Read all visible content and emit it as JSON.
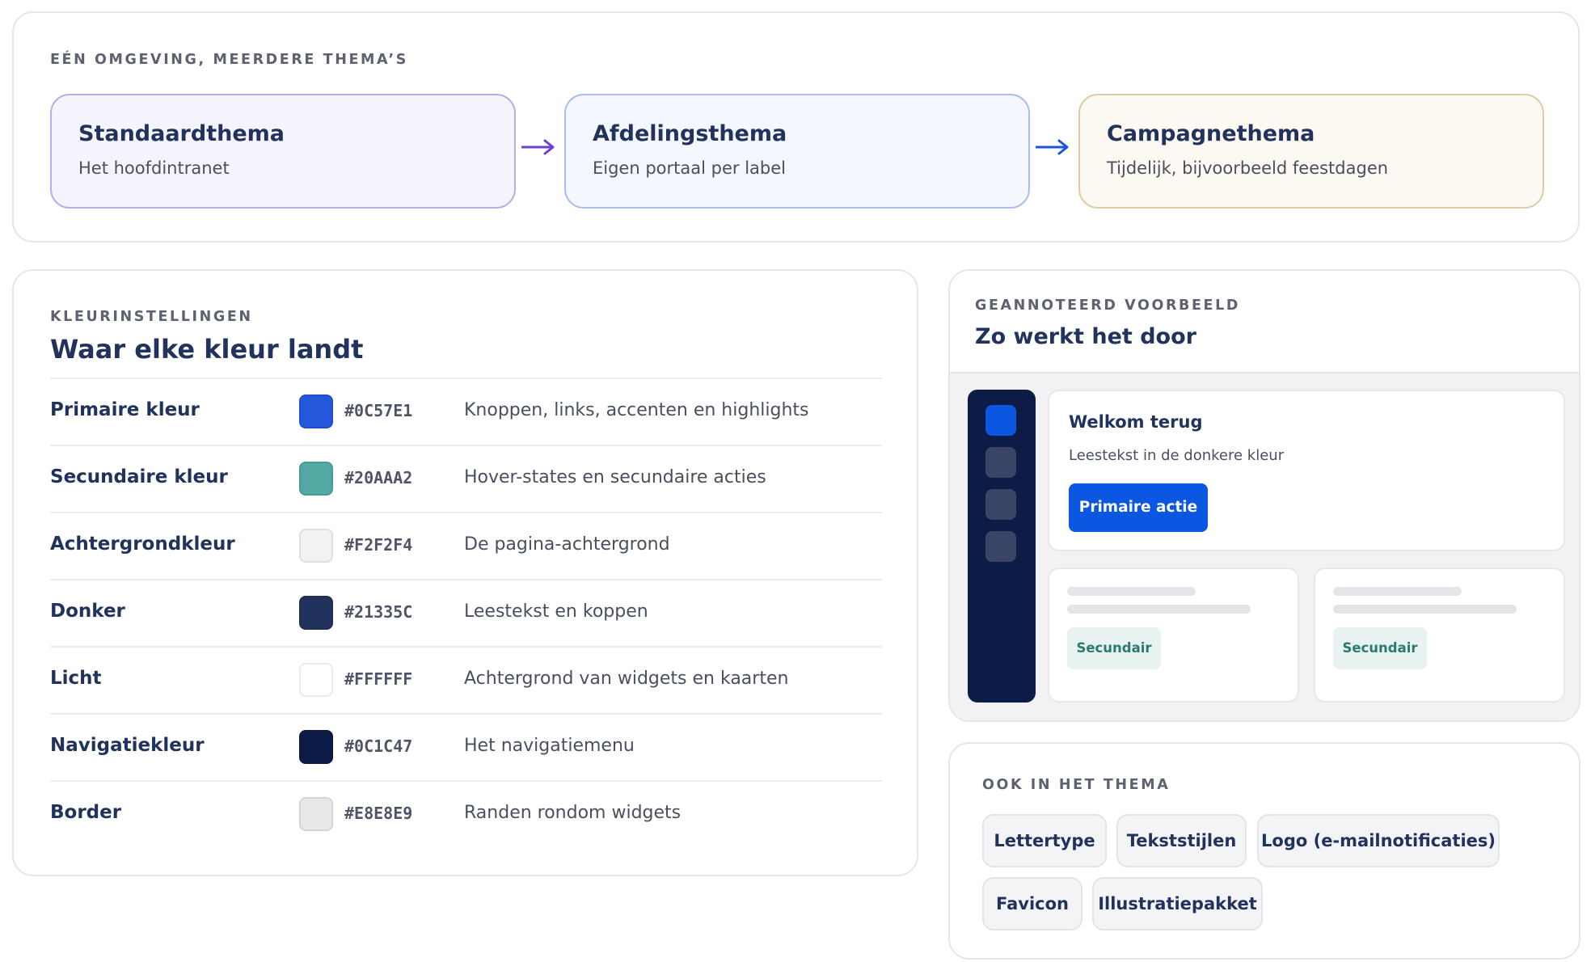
{
  "themes": {
    "heading": "EÉN OMGEVING, MEERDERE THEMA’S",
    "items": [
      {
        "title": "Standaardthema",
        "subtitle": "Het hoofdintranet",
        "border": "#b5aee6",
        "bg": "#f5f4fc"
      },
      {
        "title": "Afdelingsthema",
        "subtitle": "Eigen portaal per label",
        "border": "#a9bdee",
        "bg": "#f4f7fd"
      },
      {
        "title": "Campagnethema",
        "subtitle": "Tijdelijk, bijvoorbeeld feestdagen",
        "border": "#e0cba7",
        "bg": "#fcf8f2"
      }
    ],
    "arrow_colors": [
      "#6a3fd2",
      "#1e55d8"
    ]
  },
  "color_settings": {
    "heading": "KLEURINSTELLINGEN",
    "title": "Waar elke kleur landt",
    "rows": [
      {
        "name": "Primaire kleur",
        "hex": "#0C57E1",
        "swatch": "#2557DD",
        "desc": "Knoppen, links, accenten en highlights"
      },
      {
        "name": "Secundaire kleur",
        "hex": "#20AAA2",
        "swatch": "#52A8A2",
        "desc": "Hover-states en secundaire acties"
      },
      {
        "name": "Achtergrondkleur",
        "hex": "#F2F2F4",
        "swatch": "#F2F2F4",
        "desc": "De pagina-achtergrond"
      },
      {
        "name": "Donker",
        "hex": "#21335C",
        "swatch": "#21335C",
        "desc": "Leestekst en koppen"
      },
      {
        "name": "Licht",
        "hex": "#FFFFFF",
        "swatch": "#FFFFFF",
        "desc": "Achtergrond van widgets en kaarten"
      },
      {
        "name": "Navigatiekleur",
        "hex": "#0C1C47",
        "swatch": "#0C1C47",
        "desc": "Het navigatiemenu"
      },
      {
        "name": "Border",
        "hex": "#E8E8E9",
        "swatch": "#E8E8E9",
        "desc": "Randen rondom widgets"
      }
    ]
  },
  "example": {
    "heading": "GEANNOTEERD VOORBEELD",
    "title": "Zo werkt het door",
    "welcome_title": "Welkom terug",
    "welcome_text": "Leestekst in de donkere kleur",
    "primary_button": "Primaire actie",
    "secondary_button": "Secundair"
  },
  "also_in_theme": {
    "heading": "OOK IN HET THEMA",
    "chips": [
      "Lettertype",
      "Tekststijlen",
      "Logo (e-mailnotificaties)",
      "Favicon",
      "Illustratiepakket"
    ]
  }
}
